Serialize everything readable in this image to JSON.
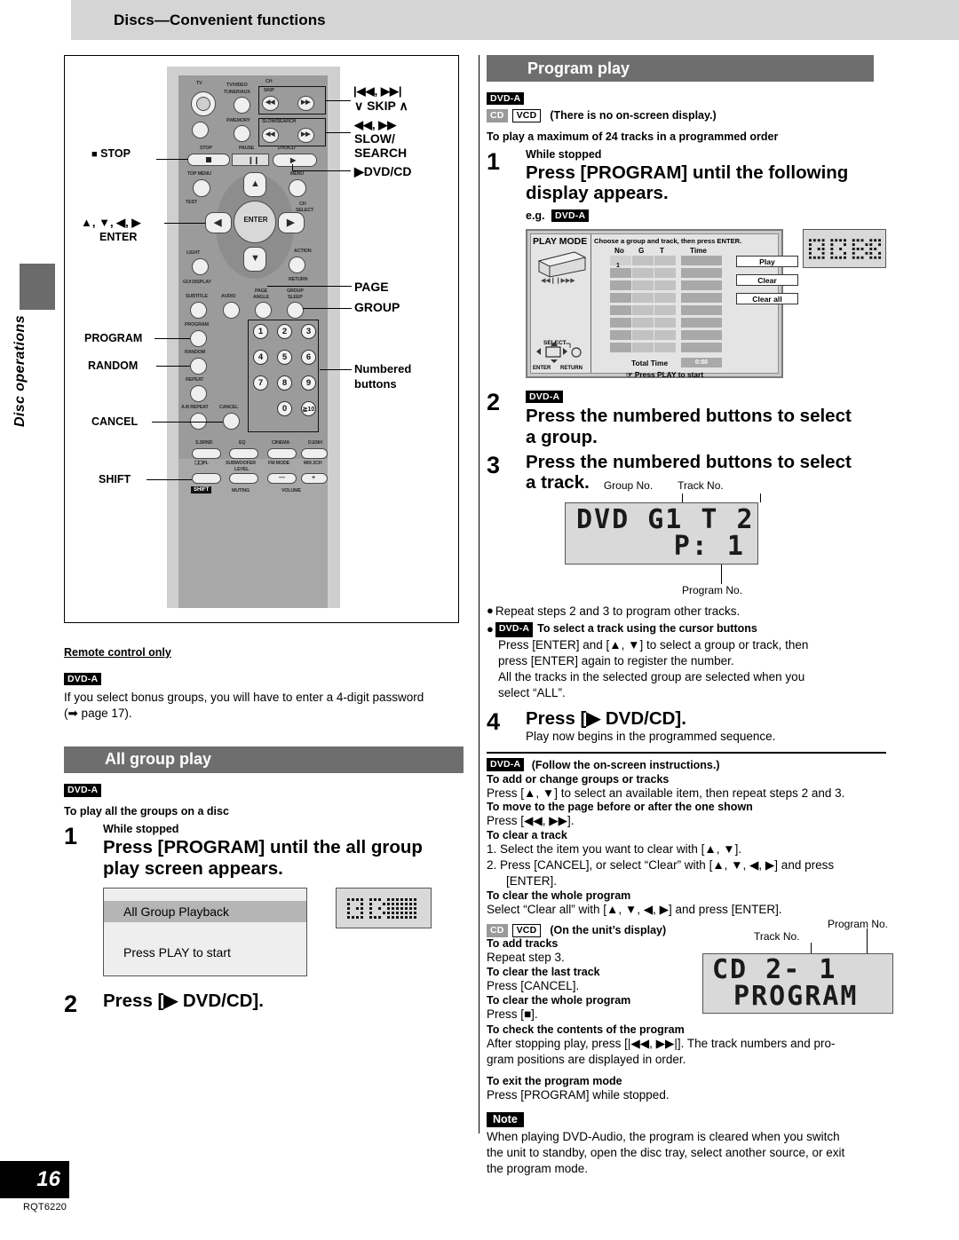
{
  "header": {
    "title": "Discs—Convenient functions"
  },
  "sidebar": {
    "tab_label": "Disc operations"
  },
  "footer": {
    "page_number": "16",
    "doc_code": "RQT6220"
  },
  "remote": {
    "callouts": {
      "stop": "STOP",
      "cursor_enter_line1": "▲, ▼, ◀, ▶",
      "cursor_enter_line2": "ENTER",
      "program": "PROGRAM",
      "random": "RANDOM",
      "cancel": "CANCEL",
      "shift": "SHIFT",
      "skip_line1": "|◀◀, ▶▶|",
      "skip_line2": "∨ SKIP ∧",
      "slow_line1": "◀◀, ▶▶",
      "slow_line2": "SLOW/",
      "slow_line3": "SEARCH",
      "dvdcd": "▶DVD/CD",
      "page": "PAGE",
      "group": "GROUP",
      "numbered_line1": "Numbered",
      "numbered_line2": "buttons"
    },
    "face_labels": {
      "tv_power": "TV",
      "tv_video": "TV/VIDEO",
      "tuner_aux": "TUNER/AUX",
      "p_memory": "P.MEMORY",
      "stop": "STOP",
      "pause": "PAUSE",
      "dvdcd": "DVD/CD",
      "top_menu": "TOP MENU",
      "menu": "MENU",
      "test": "TEST",
      "ch_select_1": "CH",
      "ch_select_2": "SELECT",
      "light": "LIGHT",
      "action": "ACTION",
      "gui_display": "GUI DISPLAY",
      "return": "RETURN",
      "subtitle": "SUBTITLE",
      "audio": "AUDIO",
      "page_angle_1": "PAGE",
      "page_angle_2": "ANGLE",
      "group_sleep_1": "GROUP",
      "group_sleep_2": "SLEEP",
      "program": "PROGRAM",
      "random": "RANDOM",
      "repeat": "REPEAT",
      "ab_repeat": "A-B REPEAT",
      "cancel": "CANCEL",
      "enter": "ENTER",
      "skip": "SKIP",
      "ch_up": "CH",
      "slow_search": "SLOW/SEARCH",
      "s_srnd": "S.SRND",
      "eq": "EQ",
      "cinema": "CINEMA",
      "d_enh": "D.ENH",
      "dpl": "PL",
      "subwoofer_1": "SUBWOOFER",
      "subwoofer_2": "LEVEL",
      "fm_mode": "FM MODE",
      "mix_2ch": "MIX 2CH",
      "shift": "SHIFT",
      "muting": "MUTING",
      "volume": "VOLUME",
      "numbers": [
        "1",
        "2",
        "3",
        "4",
        "5",
        "6",
        "7",
        "8",
        "9",
        "0",
        "≧10"
      ]
    }
  },
  "left_column": {
    "remote_only": "Remote control only",
    "dvda_tag": "DVD-A",
    "bonus_note_l1": "If you select bonus groups, you will have to enter a 4-digit password",
    "bonus_note_l2": "(➡ page 17).",
    "all_group_play": {
      "section_title": "All group play",
      "dvda_tag": "DVD-A",
      "intro": "To play all the groups on a disc",
      "step1": {
        "num": "1",
        "pre": "While stopped",
        "head_l1": "Press [PROGRAM] until the all group",
        "head_l2": "play screen appears."
      },
      "osd": {
        "line1": "All Group Playback",
        "line2": "Press PLAY to start"
      },
      "step2": {
        "num": "2",
        "head": "Press [▶ DVD/CD]."
      }
    }
  },
  "right_column": {
    "program_play": {
      "section_title": "Program play",
      "dvda_tag": "DVD-A",
      "cd_tag": "CD",
      "vcd_tag": "VCD",
      "no_osd_note": "(There is no on-screen display.)",
      "intro": "To play a maximum of 24 tracks in a programmed order",
      "step1": {
        "num": "1",
        "pre": "While stopped",
        "head_l1": "Press [PROGRAM] until the following",
        "head_l2": "display appears.",
        "eg_label": "e.g.",
        "eg_tag": "DVD-A"
      },
      "play_mode_osd": {
        "title": "PLAY MODE",
        "hint": "Choose a group and track, then press ENTER.",
        "col_no": "No",
        "col_g": "G",
        "col_t": "T",
        "col_time": "Time",
        "first_row_no": "1",
        "btn_play": "Play",
        "btn_clear": "Clear",
        "btn_clear_all": "Clear all",
        "total_time_label": "Total Time",
        "total_time_value": "0:00",
        "footer_hint": "☞ Press PLAY to start",
        "select_label": "SELECT",
        "enter_label": "ENTER",
        "return_label": "RETURN"
      },
      "step2": {
        "num": "2",
        "tag": "DVD-A",
        "head_l1": "Press the numbered buttons to select",
        "head_l2": "a group."
      },
      "step3": {
        "num": "3",
        "head_l1": "Press the numbered buttons to select",
        "head_l2": "a track."
      },
      "display_callouts": {
        "group_no": "Group No.",
        "track_no": "Track No.",
        "program_no": "Program No."
      },
      "led_dvd": {
        "line1": "DVD G1 T 2",
        "line2": "P: 1"
      },
      "repeat_note": "Repeat steps 2 and 3 to program other tracks.",
      "cursor_note": {
        "tag": "DVD-A",
        "head": "To select a track using the cursor buttons",
        "l1": "Press [ENTER] and [▲, ▼] to select a group or track, then",
        "l2": "press [ENTER] again to register the number.",
        "l3": "All the tracks in the selected group are selected when you",
        "l4": "select “ALL”."
      },
      "step4": {
        "num": "4",
        "head": "Press [▶ DVD/CD].",
        "sub": "Play now begins in the programmed sequence."
      }
    },
    "instructions": {
      "dvda_tag": "DVD-A",
      "dvda_note": "(Follow the on-screen instructions.)",
      "add_change_head": "To add or change groups or tracks",
      "add_change_body": "Press [▲, ▼] to select an available item, then repeat steps 2 and 3.",
      "move_page_head": "To move to the page before or after the one shown",
      "move_page_body": "Press [◀◀, ▶▶].",
      "clear_track_head": "To clear a track",
      "clear_track_1": "1.  Select the item you want to clear with [▲, ▼].",
      "clear_track_2a": "2.  Press [CANCEL], or select “Clear” with [▲, ▼, ◀, ▶] and press",
      "clear_track_2b": "[ENTER].",
      "clear_whole_head": "To clear the whole program",
      "clear_whole_body": "Select “Clear all” with [▲, ▼, ◀, ▶] and press [ENTER].",
      "cd_tag": "CD",
      "vcd_tag": "VCD",
      "unit_display_note": "(On the unit’s display)",
      "add_tracks_head": "To add tracks",
      "add_tracks_body": "Repeat step 3.",
      "clear_last_head": "To clear the last track",
      "clear_last_body": "Press [CANCEL].",
      "clear_whole2_head": "To clear the whole program",
      "clear_whole2_body": "Press [■].",
      "check_head": "To check the contents of the program",
      "check_l1": "After stopping play, press [|◀◀, ▶▶|]. The track numbers and pro-",
      "check_l2": "gram positions are displayed in order.",
      "exit_head": "To exit the program mode",
      "exit_body": "Press [PROGRAM] while stopped.",
      "led_cd": {
        "line1": "CD     2- 1",
        "line2": "PROGRAM"
      },
      "callout_track_no": "Track No.",
      "callout_program_no": "Program No."
    },
    "note": {
      "tag": "Note",
      "l1": "When playing DVD-Audio, the program is cleared when you switch",
      "l2": "the unit to standby, open the disc tray, select another source, or exit",
      "l3": "the program mode."
    }
  }
}
